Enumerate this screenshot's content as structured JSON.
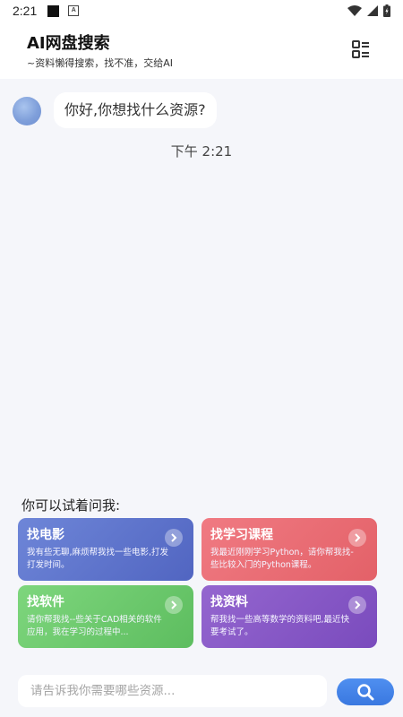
{
  "status_bar": {
    "time": "2:21",
    "icons": [
      "notification-square-icon",
      "a-badge-icon",
      "wifi-icon",
      "signal-icon",
      "battery-icon"
    ]
  },
  "header": {
    "title": "AI网盘搜索",
    "subtitle": "~资料懒得搜索，找不准，交给AI",
    "menu_icon": "list-menu-icon"
  },
  "chat": {
    "messages": [
      {
        "sender": "ai",
        "avatar_icon": "avatar",
        "text": "你好,你想找什么资源?"
      }
    ],
    "timestamp": "下午 2:21"
  },
  "suggestions": {
    "title": "你可以试着问我:",
    "cards": [
      {
        "title": "找电影",
        "desc": "我有些无聊,麻烦帮我找一些电影,打发打发时间。",
        "color": "#5a6fc8"
      },
      {
        "title": "找学习课程",
        "desc": "我最近刚刚学习Python，请你帮我找-些比较入门的Python课程。",
        "color": "#e96a71"
      },
      {
        "title": "找软件",
        "desc": "请你帮我找--些关于CAD相关的软件应用，我在学习的过程中...",
        "color": "#6cc96c"
      },
      {
        "title": "找资料",
        "desc": "帮我找一些高等数学的资料吧,最近快要考试了。",
        "color": "#8558c5"
      }
    ]
  },
  "input": {
    "placeholder": "请告诉我你需要哪些资源...",
    "search_icon": "search-icon",
    "accent": "#3f7fe6"
  }
}
